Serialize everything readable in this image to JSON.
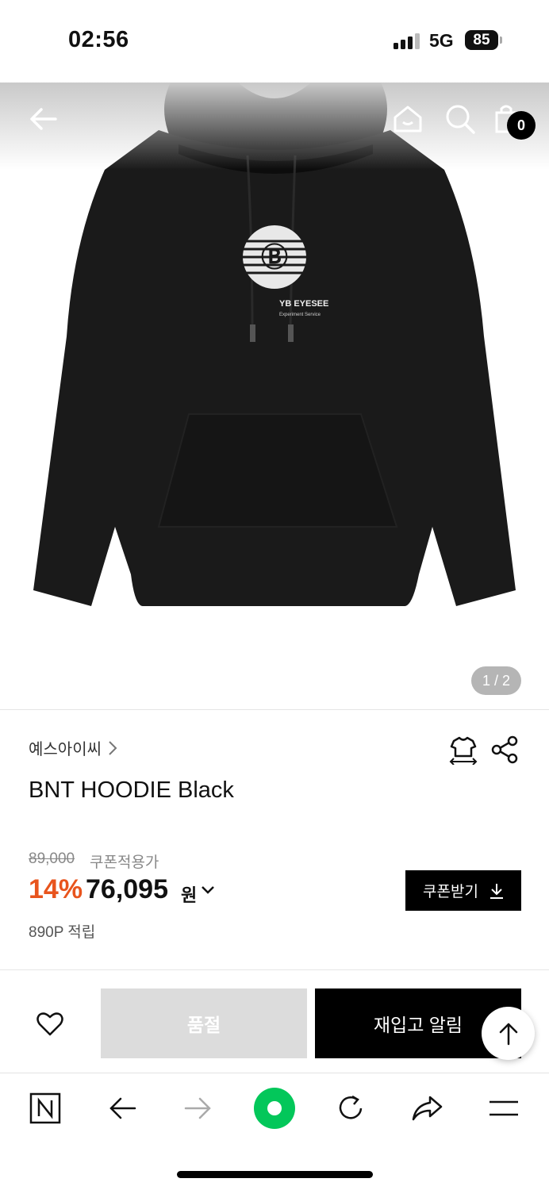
{
  "status": {
    "time": "02:56",
    "network": "5G",
    "battery": "85"
  },
  "header": {
    "back_icon": "back-arrow-icon",
    "home_icon": "home-icon",
    "search_icon": "search-icon",
    "cart_icon": "cart-icon",
    "cart_count": "0"
  },
  "gallery": {
    "counter": "1 / 2",
    "product_print": "YB EYESEE",
    "product_print_sub": "Experiment Service"
  },
  "product": {
    "brand": "예스아이씨",
    "title": "BNT HOODIE Black",
    "original_price": "89,000",
    "coupon_label": "쿠폰적용가",
    "discount": "14%",
    "price": "76,095",
    "currency": "원",
    "coupon_button": "쿠폰받기",
    "points": "890P 적립"
  },
  "purchase": {
    "soldout_label": "품절",
    "restock_label": "재입고 알림"
  },
  "colors": {
    "accent": "#e8541d",
    "green": "#03c75a",
    "black": "#000000"
  },
  "toolbar": {
    "items": [
      "naver-icon",
      "back-icon",
      "forward-icon",
      "green-dot-icon",
      "refresh-icon",
      "share-icon",
      "menu-icon"
    ]
  }
}
